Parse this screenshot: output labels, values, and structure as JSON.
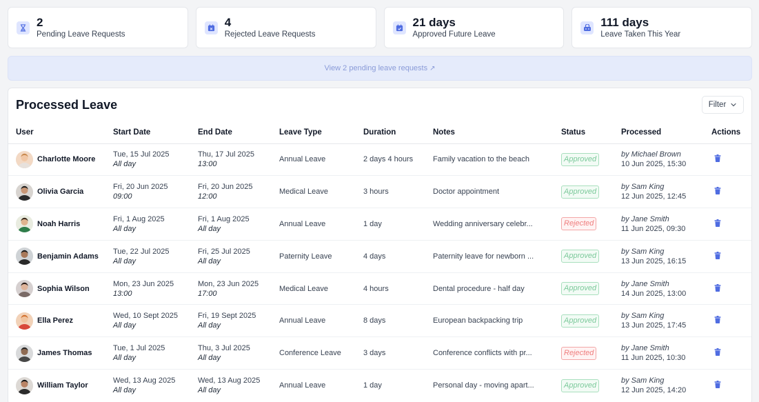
{
  "colors": {
    "accent": "#4f6ce1",
    "icon_bg": "#dfe5ff",
    "approved": "#7bc99a",
    "rejected": "#ef7d7d",
    "banner_bg": "#e5ebfb"
  },
  "stats": [
    {
      "icon": "hourglass-icon",
      "value": "2",
      "label": "Pending Leave Requests"
    },
    {
      "icon": "calendar-x-icon",
      "value": "4",
      "label": "Rejected Leave Requests"
    },
    {
      "icon": "calendar-check-icon",
      "value": "21 days",
      "label": "Approved Future Leave"
    },
    {
      "icon": "beach-bag-icon",
      "value": "111 days",
      "label": "Leave Taken This Year"
    }
  ],
  "banner": {
    "text": "View 2 pending leave requests",
    "icon": "external-link-icon",
    "arrow": "↗"
  },
  "panel": {
    "title": "Processed Leave",
    "filter_label": "Filter"
  },
  "table": {
    "headers": [
      "User",
      "Start Date",
      "End Date",
      "Leave Type",
      "Duration",
      "Notes",
      "Status",
      "Processed",
      "Actions"
    ],
    "rows": [
      {
        "user": "Charlotte Moore",
        "start_date": "Tue, 15 Jul 2025",
        "start_time": "All day",
        "end_date": "Thu, 17 Jul 2025",
        "end_time": "13:00",
        "type": "Annual Leave",
        "duration": "2 days 4 hours",
        "notes": "Family vacation to the beach",
        "status": "Approved",
        "by": "by Michael Brown",
        "processed_at": "10 Jun 2025, 15:30"
      },
      {
        "user": "Olivia Garcia",
        "start_date": "Fri, 20 Jun 2025",
        "start_time": "09:00",
        "end_date": "Fri, 20 Jun 2025",
        "end_time": "12:00",
        "type": "Medical Leave",
        "duration": "3 hours",
        "notes": "Doctor appointment",
        "status": "Approved",
        "by": "by Sam King",
        "processed_at": "12 Jun 2025, 12:45"
      },
      {
        "user": "Noah Harris",
        "start_date": "Fri, 1 Aug 2025",
        "start_time": "All day",
        "end_date": "Fri, 1 Aug 2025",
        "end_time": "All day",
        "type": "Annual Leave",
        "duration": "1 day",
        "notes": "Wedding anniversary celebr...",
        "status": "Rejected",
        "by": "by Jane Smith",
        "processed_at": "11 Jun 2025, 09:30"
      },
      {
        "user": "Benjamin Adams",
        "start_date": "Tue, 22 Jul 2025",
        "start_time": "All day",
        "end_date": "Fri, 25 Jul 2025",
        "end_time": "All day",
        "type": "Paternity Leave",
        "duration": "4 days",
        "notes": "Paternity leave for newborn ...",
        "status": "Approved",
        "by": "by Sam King",
        "processed_at": "13 Jun 2025, 16:15"
      },
      {
        "user": "Sophia Wilson",
        "start_date": "Mon, 23 Jun 2025",
        "start_time": "13:00",
        "end_date": "Mon, 23 Jun 2025",
        "end_time": "17:00",
        "type": "Medical Leave",
        "duration": "4 hours",
        "notes": "Dental procedure - half day",
        "status": "Approved",
        "by": "by Jane Smith",
        "processed_at": "14 Jun 2025, 13:00"
      },
      {
        "user": "Ella Perez",
        "start_date": "Wed, 10 Sept 2025",
        "start_time": "All day",
        "end_date": "Fri, 19 Sept 2025",
        "end_time": "All day",
        "type": "Annual Leave",
        "duration": "8 days",
        "notes": "European backpacking trip",
        "status": "Approved",
        "by": "by Sam King",
        "processed_at": "13 Jun 2025, 17:45"
      },
      {
        "user": "James Thomas",
        "start_date": "Tue, 1 Jul 2025",
        "start_time": "All day",
        "end_date": "Thu, 3 Jul 2025",
        "end_time": "All day",
        "type": "Conference Leave",
        "duration": "3 days",
        "notes": "Conference conflicts with pr...",
        "status": "Rejected",
        "by": "by Jane Smith",
        "processed_at": "11 Jun 2025, 10:30"
      },
      {
        "user": "William Taylor",
        "start_date": "Wed, 13 Aug 2025",
        "start_time": "All day",
        "end_date": "Wed, 13 Aug 2025",
        "end_time": "All day",
        "type": "Annual Leave",
        "duration": "1 day",
        "notes": "Personal day - moving apart...",
        "status": "Approved",
        "by": "by Sam King",
        "processed_at": "12 Jun 2025, 14:20"
      }
    ],
    "action_icon": "trash-icon"
  }
}
